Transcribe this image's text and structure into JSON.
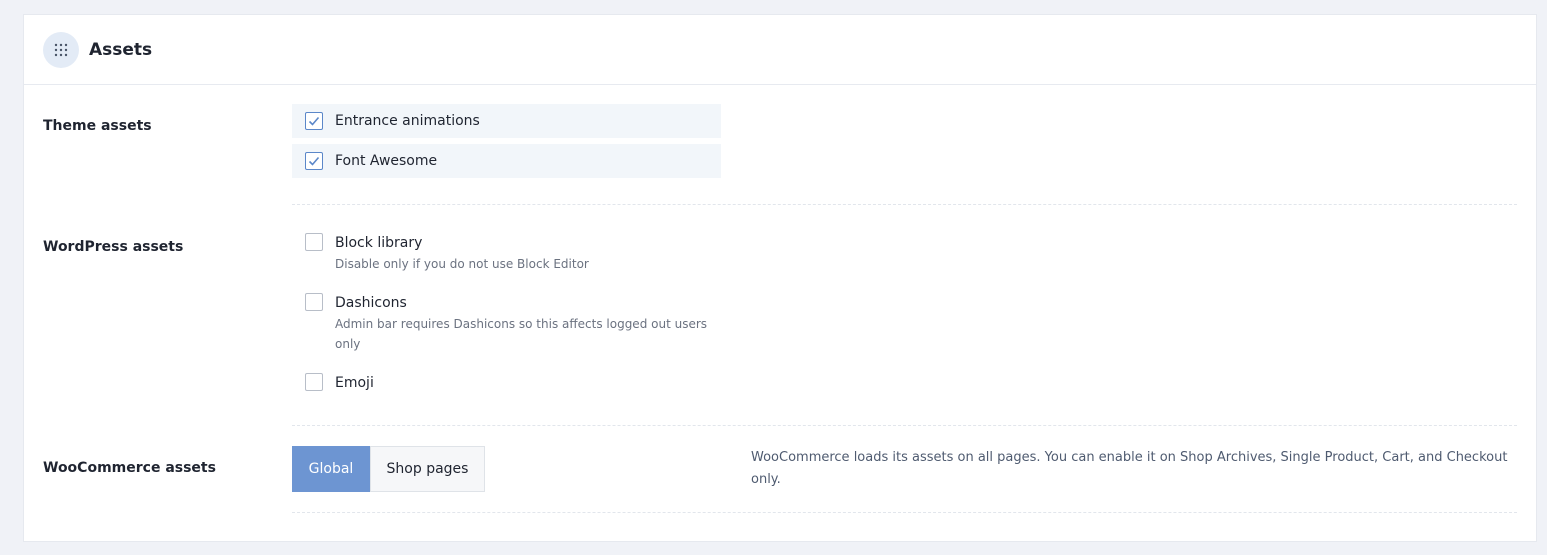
{
  "header": {
    "title": "Assets",
    "icon": "grip-dots-icon"
  },
  "theme_assets": {
    "label": "Theme assets",
    "items": [
      {
        "label": "Entrance animations",
        "checked": true
      },
      {
        "label": "Font Awesome",
        "checked": true
      }
    ]
  },
  "wordpress_assets": {
    "label": "WordPress assets",
    "items": [
      {
        "label": "Block library",
        "desc": "Disable only if you do not use Block Editor",
        "checked": false
      },
      {
        "label": "Dashicons",
        "desc": "Admin bar requires Dashicons so this affects logged out users only",
        "checked": false
      },
      {
        "label": "Emoji",
        "checked": false
      }
    ]
  },
  "woocommerce_assets": {
    "label": "WooCommerce assets",
    "options": [
      {
        "label": "Global",
        "active": true
      },
      {
        "label": "Shop pages",
        "active": false
      }
    ],
    "note": "WooCommerce loads its assets on all pages. You can enable it on Shop Archives, Single Product, Cart, and Checkout only."
  },
  "colors": {
    "accent": "#6d95d2",
    "checkbox_border_checked": "#5b87c9"
  }
}
